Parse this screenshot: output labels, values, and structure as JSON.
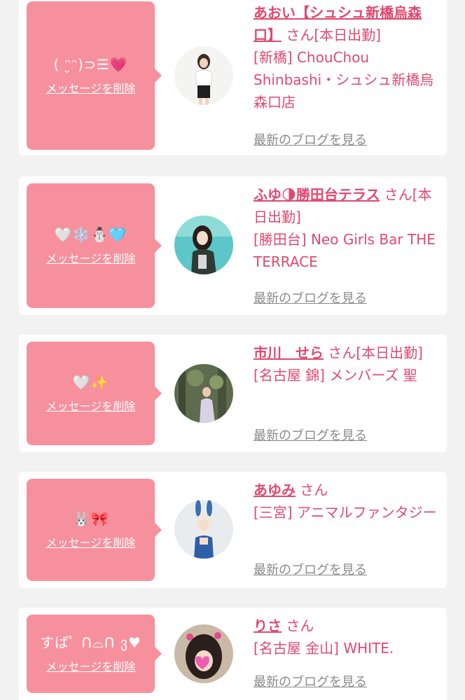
{
  "delete_label": "メッセージを削除",
  "blog_label": "最新のブログを見る",
  "colors": {
    "bubble": "#f7909d",
    "accent": "#e0496f",
    "muted": "#8a8a8a",
    "background": "#f2f2f2"
  },
  "cards": [
    {
      "message": "( ᵔ̮ᵔ)⊃☰💗",
      "name": "あおい【シュシュ新橋烏森口】",
      "suffix": " さん[本日出勤]",
      "shop": "[新橋] ChouChou Shinbashi・シュシュ新橋烏森口店",
      "avatar_icon": "woman-white-blouse-photo"
    },
    {
      "message": "🤍❄️⛄🩵",
      "name": "ふゆ🌗勝田台テラス",
      "suffix": " さん[本日出勤]",
      "shop": "[勝田台] Neo Girls Bar THE TERRACE",
      "avatar_icon": "woman-teal-background-photo"
    },
    {
      "message": "🤍✨",
      "name": "市川　せら",
      "suffix": " さん[本日出勤]",
      "shop": "[名古屋 錦] メンバーズ 聖",
      "avatar_icon": "woman-kimono-forest-photo"
    },
    {
      "message": "🐰🎀",
      "name": "あゆみ",
      "suffix": " さん",
      "shop": "[三宮] アニマルファンタジー",
      "avatar_icon": "bunny-costume-photo"
    },
    {
      "message": "すばﾟ ᑎ⌓ᑎ ვ♥",
      "name": "りさ",
      "suffix": " さん",
      "shop": "[名古屋 金山] WHITE.",
      "avatar_icon": "woman-heart-stickers-photo"
    }
  ]
}
